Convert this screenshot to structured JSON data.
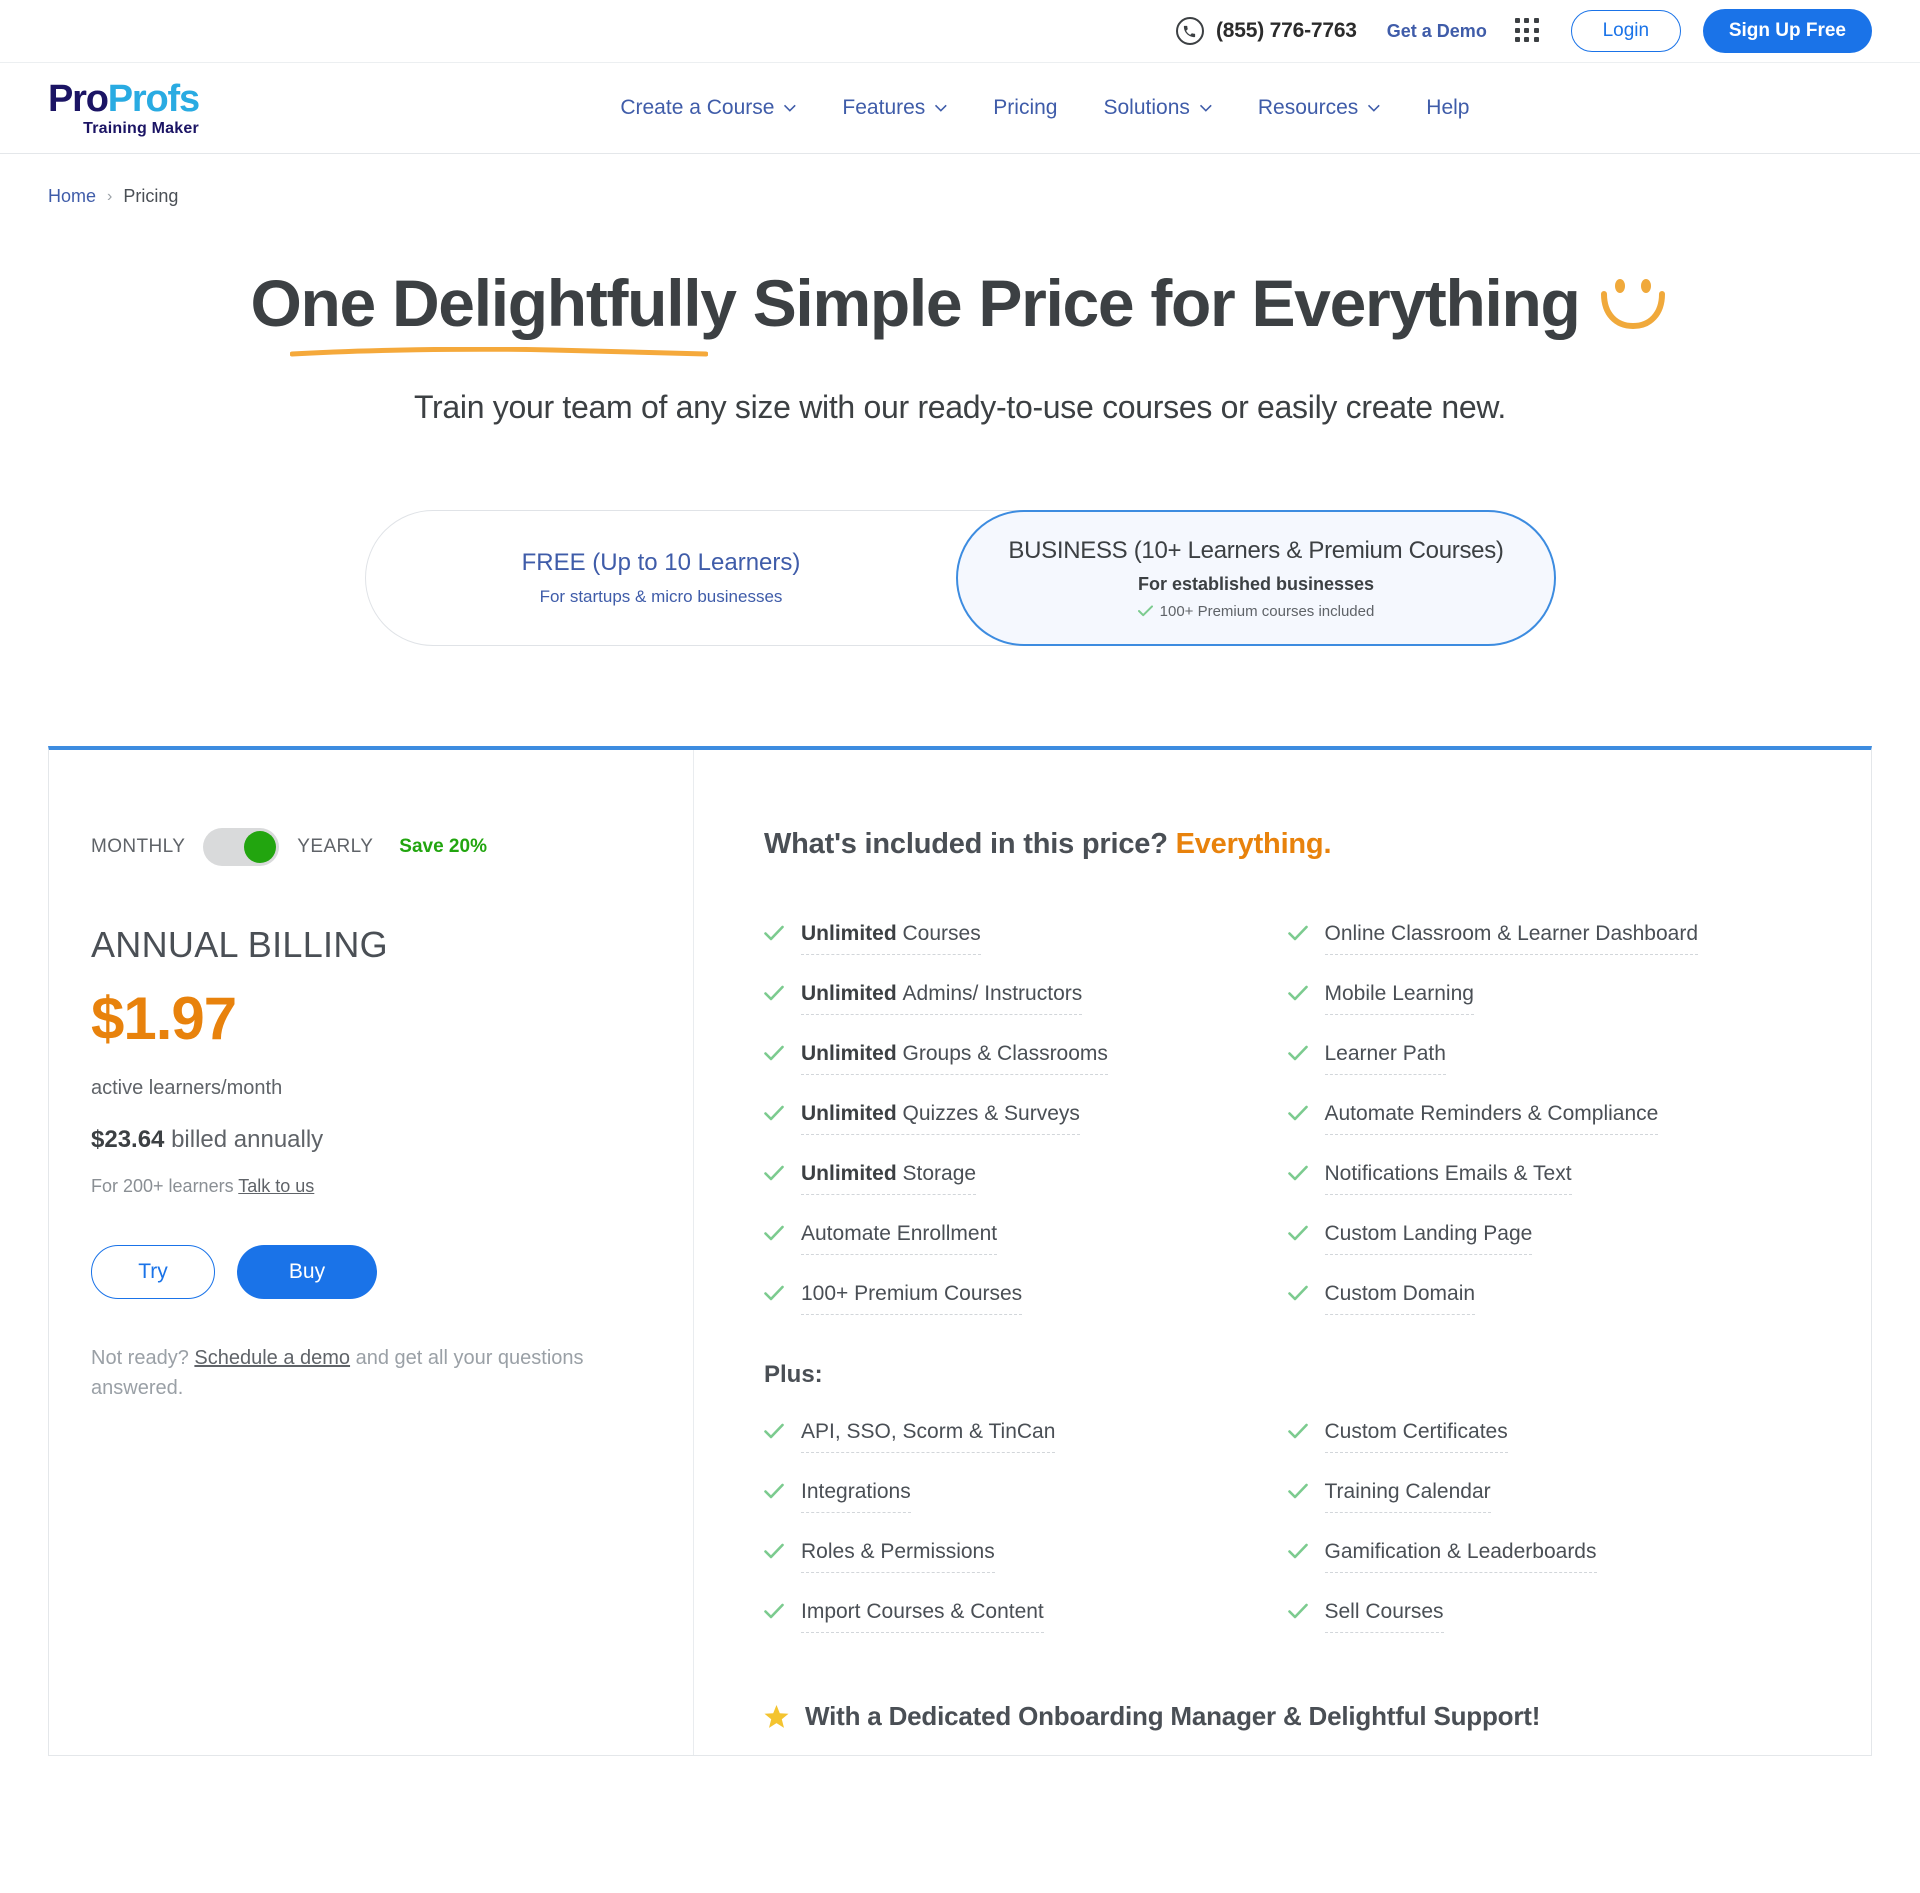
{
  "topbar": {
    "phone": "(855) 776-7763",
    "get_demo": "Get a Demo",
    "login": "Login",
    "signup": "Sign Up Free"
  },
  "nav": {
    "logo_pro1": "Pro",
    "logo_pro2": "Profs",
    "logo_sub": "Training Maker",
    "links": [
      {
        "label": "Create a Course",
        "caret": true
      },
      {
        "label": "Features",
        "caret": true
      },
      {
        "label": "Pricing",
        "caret": false
      },
      {
        "label": "Solutions",
        "caret": true
      },
      {
        "label": "Resources",
        "caret": true
      },
      {
        "label": "Help",
        "caret": false
      }
    ]
  },
  "breadcrumb": {
    "home": "Home",
    "separator": "›",
    "current": "Pricing"
  },
  "hero": {
    "title": "One Delightfully Simple Price for Everything",
    "subtitle": "Train your team of any size with our ready-to-use courses or easily create new."
  },
  "plans": {
    "free": {
      "title": "FREE (Up to 10 Learners)",
      "subtitle": "For startups & micro businesses"
    },
    "business": {
      "title": "BUSINESS (10+ Learners & Premium Courses)",
      "subtitle": "For established businesses",
      "note": "100+ Premium courses included"
    }
  },
  "billing": {
    "monthly_label": "MONTHLY",
    "yearly_label": "YEARLY",
    "save_label": "Save 20%",
    "heading": "ANNUAL BILLING",
    "price": "$1.97",
    "price_note": "active learners/month",
    "annual_amount": "$23.64",
    "annual_suffix": " billed annually",
    "learners_prefix": "For 200+ learners ",
    "learners_link": "Talk to us",
    "try_label": "Try",
    "buy_label": "Buy",
    "notready_prefix": "Not ready? ",
    "notready_link": "Schedule a demo",
    "notready_suffix": " and get all your questions answered."
  },
  "features": {
    "heading_plain": "What's included in this price? ",
    "heading_accent": "Everything.",
    "items": [
      {
        "bold": "Unlimited ",
        "rest": "Courses"
      },
      {
        "bold": "",
        "rest": "Online Classroom & Learner Dashboard"
      },
      {
        "bold": "Unlimited ",
        "rest": "Admins/ Instructors"
      },
      {
        "bold": "",
        "rest": "Mobile Learning"
      },
      {
        "bold": "Unlimited ",
        "rest": "Groups & Classrooms"
      },
      {
        "bold": "",
        "rest": "Learner Path"
      },
      {
        "bold": "Unlimited ",
        "rest": "Quizzes & Surveys"
      },
      {
        "bold": "",
        "rest": "Automate Reminders & Compliance"
      },
      {
        "bold": "Unlimited ",
        "rest": "Storage"
      },
      {
        "bold": "",
        "rest": "Notifications Emails & Text"
      },
      {
        "bold": "",
        "rest": "Automate Enrollment"
      },
      {
        "bold": "",
        "rest": "Custom Landing Page"
      },
      {
        "bold": "",
        "rest": "100+ Premium Courses"
      },
      {
        "bold": "",
        "rest": "Custom Domain"
      }
    ],
    "plus_heading": "Plus:",
    "plus_items": [
      {
        "bold": "",
        "rest": "API, SSO, Scorm & TinCan"
      },
      {
        "bold": "",
        "rest": "Custom Certificates"
      },
      {
        "bold": "",
        "rest": "Integrations"
      },
      {
        "bold": "",
        "rest": "Training Calendar"
      },
      {
        "bold": "",
        "rest": "Roles & Permissions"
      },
      {
        "bold": "",
        "rest": "Gamification & Leaderboards"
      },
      {
        "bold": "",
        "rest": "Import Courses & Content"
      },
      {
        "bold": "",
        "rest": "Sell Courses"
      }
    ],
    "onboarding": "With a Dedicated Onboarding Manager & Delightful Support!"
  },
  "colors": {
    "brand_blue": "#1a73e8",
    "nav_blue": "#3f5ca9",
    "accent_orange": "#e8820c",
    "check_green": "#7ccb8f",
    "save_green": "#22a50f",
    "logo_navy": "#1b1464",
    "logo_cyan": "#29abe2",
    "star_yellow": "#f4c430"
  }
}
